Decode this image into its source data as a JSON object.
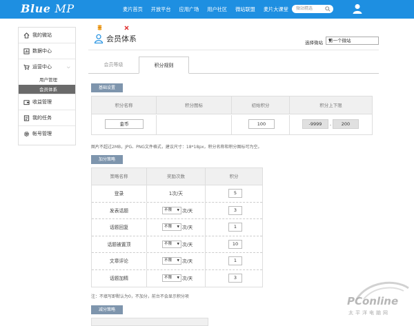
{
  "header": {
    "logo_main": "Blue",
    "logo_sub": "MP",
    "nav": [
      "麦片首页",
      "开放平台",
      "应用广场",
      "用户社区",
      "微站联盟",
      "麦片大课堂"
    ],
    "search_placeholder": "微站精选"
  },
  "sidebar": {
    "items": [
      {
        "label": "我的微站",
        "icon": "home-icon"
      },
      {
        "label": "数据中心",
        "icon": "chart-icon"
      },
      {
        "label": "运营中心",
        "icon": "cart-icon"
      },
      {
        "label": "收益管理",
        "icon": "wallet-icon"
      },
      {
        "label": "我的任务",
        "icon": "task-icon"
      },
      {
        "label": "帐号管理",
        "icon": "gear-icon"
      }
    ],
    "subitems": [
      "用户管理",
      "会员体系"
    ],
    "active_sub": "会员体系"
  },
  "page": {
    "title": "会员体系",
    "select_label": "选择微站",
    "select_value": "第一个微站"
  },
  "tabs": [
    "会员等级",
    "积分规则"
  ],
  "basic": {
    "header": "基础设置",
    "columns": [
      "积分名称",
      "积分图标",
      "初始积分",
      "积分上下限"
    ],
    "name_value": "金币",
    "initial_value": "100",
    "min_value": "-9999",
    "dash": "-",
    "max_value": "200",
    "note": "图片不超过2MB，JPG、PNG文件格式，建议尺寸：18*18px，积分名称和积分图标可为空。"
  },
  "add": {
    "header": "加分策略",
    "columns": [
      "策略名称",
      "奖励次数",
      "积分"
    ],
    "rows": [
      {
        "name": "登录",
        "freq": "1次/天",
        "select": "",
        "per": "",
        "points": "5"
      },
      {
        "name": "发表话题",
        "freq": "",
        "select": "不限",
        "per": "次/天",
        "points": "3"
      },
      {
        "name": "话题回复",
        "freq": "",
        "select": "不限",
        "per": "次/天",
        "points": "1"
      },
      {
        "name": "话题被置顶",
        "freq": "",
        "select": "不限",
        "per": "次/天",
        "points": "10"
      },
      {
        "name": "文章评论",
        "freq": "",
        "select": "不限",
        "per": "次/天",
        "points": "1"
      },
      {
        "name": "话题加精",
        "freq": "",
        "select": "不限",
        "per": "次/天",
        "points": "3"
      }
    ],
    "note": "注：不填写即默认为0，不加分，前台不会显示积分项"
  },
  "minus": {
    "header": "减分策略"
  },
  "watermark": {
    "text": "PConline",
    "sub": "太平洋电脑网"
  },
  "colors": {
    "topbar": "#1e8fe1",
    "section_header": "#7e95ad",
    "delete": "#e03030",
    "coin": "#f0a020"
  }
}
